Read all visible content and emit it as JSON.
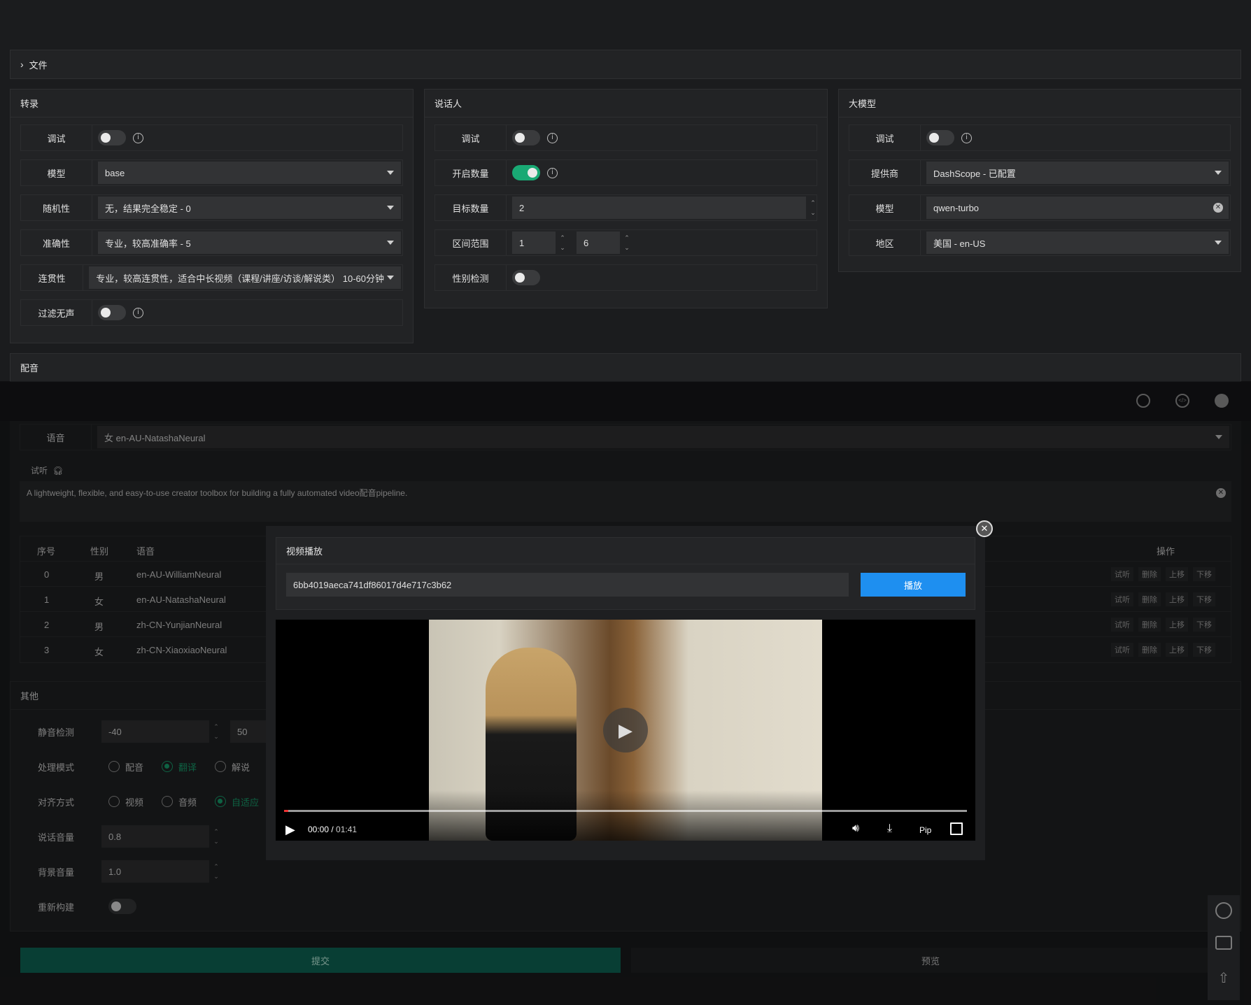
{
  "files_section": {
    "label": "文件"
  },
  "transcribe": {
    "title": "转录",
    "debug_label": "调试",
    "model_label": "模型",
    "model_value": "base",
    "randomness_label": "随机性",
    "randomness_value": "无，结果完全稳定 - 0",
    "accuracy_label": "准确性",
    "accuracy_value": "专业，较高准确率 - 5",
    "coherence_label": "连贯性",
    "coherence_value": "专业，较高连贯性，适合中长视频（课程/讲座/访谈/解说类） 10-60分钟",
    "filter_label": "过滤无声"
  },
  "speaker": {
    "title": "说话人",
    "debug_label": "调试",
    "enable_count_label": "开启数量",
    "target_count_label": "目标数量",
    "target_count_value": "2",
    "range_label": "区间范围",
    "range_min": "1",
    "range_max": "6",
    "gender_label": "性别检测"
  },
  "llm": {
    "title": "大模型",
    "debug_label": "调试",
    "provider_label": "提供商",
    "provider_value": "DashScope - 已配置",
    "model_label": "模型",
    "model_value": "qwen-turbo",
    "region_label": "地区",
    "region_value": "美国 - en-US"
  },
  "dubbing": {
    "title": "配音",
    "voice_label": "语音",
    "voice_value": "女 en-AU-NatashaNeural",
    "listen_label": "试听",
    "text_value": "A lightweight, flexible, and easy-to-use creator toolbox for building a fully automated video配音pipeline.",
    "table_headers": [
      "序号",
      "性别",
      "语音",
      "操作"
    ],
    "rows": [
      {
        "idx": "0",
        "gender": "男",
        "voice": "en-AU-WilliamNeural"
      },
      {
        "idx": "1",
        "gender": "女",
        "voice": "en-AU-NatashaNeural"
      },
      {
        "idx": "2",
        "gender": "男",
        "voice": "zh-CN-YunjianNeural"
      },
      {
        "idx": "3",
        "gender": "女",
        "voice": "zh-CN-XiaoxiaoNeural"
      }
    ],
    "actions": [
      "试听",
      "删除",
      "上移",
      "下移"
    ]
  },
  "other": {
    "title": "其他",
    "silence_label": "静音检测",
    "silence_a": "-40",
    "silence_b": "50",
    "mode_label": "处理模式",
    "mode_options": [
      "配音",
      "翻译",
      "解说"
    ],
    "align_label": "对齐方式",
    "align_options": [
      "视频",
      "音频",
      "自适应"
    ],
    "speech_vol_label": "说话音量",
    "speech_vol_value": "0.8",
    "bg_vol_label": "背景音量",
    "bg_vol_value": "1.0",
    "rebuild_label": "重新构建"
  },
  "footer": {
    "submit_label": "提交",
    "preview_label": "预览"
  },
  "video_modal": {
    "title": "视频播放",
    "id_value": "6bb4019aeca741df86017d4e717c3b62",
    "play_button": "播放",
    "time_current": "00:00",
    "time_total": "01:41",
    "pip_label": "Pip",
    "progress": 0.0
  },
  "colors": {
    "accent_green": "#19a974",
    "accent_blue": "#1e8ff0",
    "submit_bg": "#0f6b5a"
  }
}
